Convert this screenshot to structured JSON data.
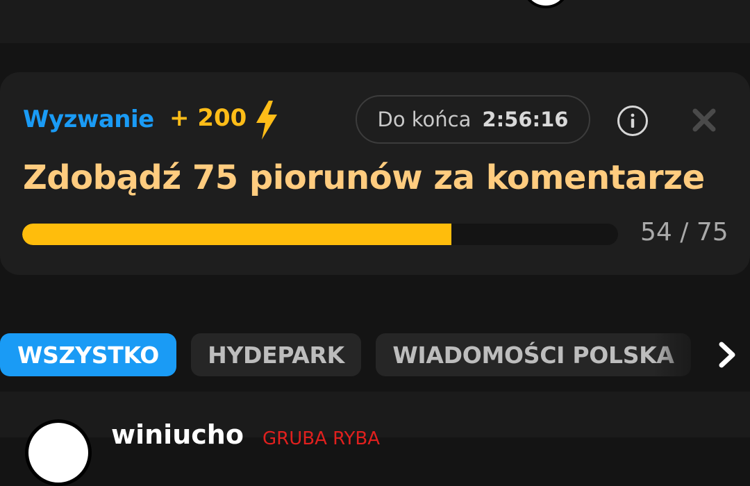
{
  "challenge": {
    "label": "Wyzwanie",
    "reward": "+ 200",
    "timer_label": "Do końca",
    "timer_value": "2:56:16",
    "title": "Zdobądź 75 piorunów za komentarze",
    "progress_current": 54,
    "progress_total": 75,
    "progress_text": "54 / 75"
  },
  "tabs": [
    {
      "label": "WSZYSTKO",
      "active": true
    },
    {
      "label": "HYDEPARK",
      "active": false
    },
    {
      "label": "WIADOMOŚCI POLSKA",
      "active": false
    }
  ],
  "post": {
    "username": "winiucho",
    "tag": "GRUBA RYBA"
  },
  "colors": {
    "accent_blue": "#1a9bf5",
    "accent_yellow": "#ffbd0c",
    "title_peach": "#ffcc7f",
    "tag_red": "#e0201e",
    "background": "#141414"
  },
  "icons": [
    "lightning-icon",
    "info-icon",
    "close-icon",
    "chevron-right-icon"
  ]
}
